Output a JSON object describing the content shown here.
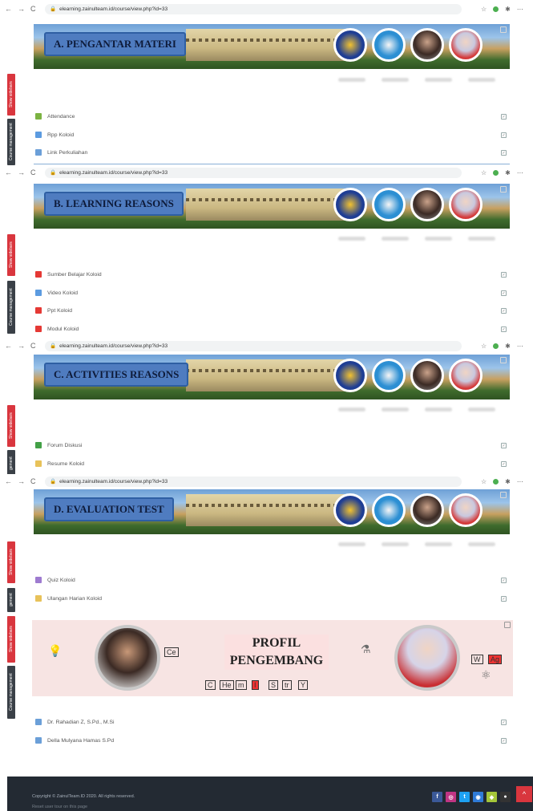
{
  "browser": {
    "url": "elearning.zainulteam.id/course/view.php?id=33",
    "back": "←",
    "forward": "→",
    "reload": "C",
    "lock": "🔒",
    "star": "☆",
    "menu": "⋯"
  },
  "side_tabs": {
    "show_sidebars": "Show sidebars",
    "course_management": "Course management",
    "course_management_short": "gement"
  },
  "sections": [
    {
      "title": "A. PENGANTAR MATERI",
      "activities": [
        {
          "label": "Attendance",
          "icon_color": "#7cb342"
        },
        {
          "label": "Rpp Koloid",
          "icon_color": "#5c9be0"
        },
        {
          "label": "Link Perkuliahan",
          "icon_color": "#6b9fd8"
        }
      ]
    },
    {
      "title": "B. LEARNING REASONS",
      "activities": [
        {
          "label": "Sumber Belajar Koloid",
          "icon_color": "#e53935"
        },
        {
          "label": "Video Koloid",
          "icon_color": "#5c9be0"
        },
        {
          "label": "Ppt Koloid",
          "icon_color": "#e53935"
        },
        {
          "label": "Modul Koloid",
          "icon_color": "#e53935"
        }
      ]
    },
    {
      "title": "C. ACTIVITIES REASONS",
      "activities": [
        {
          "label": "Forum Diskusi",
          "icon_color": "#43a047"
        },
        {
          "label": "Resume Koloid",
          "icon_color": "#e8c25a"
        }
      ]
    },
    {
      "title": "D. EVALUATION TEST",
      "activities": [
        {
          "label": "Quiz Koloid",
          "icon_color": "#9e7bd0"
        },
        {
          "label": "Ulangan Harian Koloid",
          "icon_color": "#e8c25a"
        }
      ]
    }
  ],
  "profile": {
    "title_line1": "PROFIL",
    "title_line2": "PENGEMBANG",
    "chem_letters": [
      "C",
      "He",
      "m",
      "I",
      "S",
      "tr",
      "Y"
    ],
    "ce": "Ce",
    "w": "W",
    "ag": "Ag",
    "team": [
      {
        "label": "Dr. Rahadian Z, S.Pd., M.Si"
      },
      {
        "label": "Della Mulyana Hamas S.Pd"
      }
    ]
  },
  "footer": {
    "copyright": "Copyright © ZainulTeam.ID 2020. All rights reserved.",
    "reset": "Reset user tour on this page",
    "socials": [
      {
        "icon": "facebook-icon",
        "glyph": "f",
        "color": "#3b5998"
      },
      {
        "icon": "instagram-icon",
        "glyph": "◎",
        "color": "#c13584"
      },
      {
        "icon": "twitter-icon",
        "glyph": "t",
        "color": "#1da1f2"
      },
      {
        "icon": "location-icon",
        "glyph": "◉",
        "color": "#2f7bd8"
      },
      {
        "icon": "android-icon",
        "glyph": "◆",
        "color": "#a4c639"
      },
      {
        "icon": "apple-icon",
        "glyph": "●",
        "color": "#333333"
      }
    ],
    "top_glyph": "^"
  },
  "check_glyph": "✓"
}
